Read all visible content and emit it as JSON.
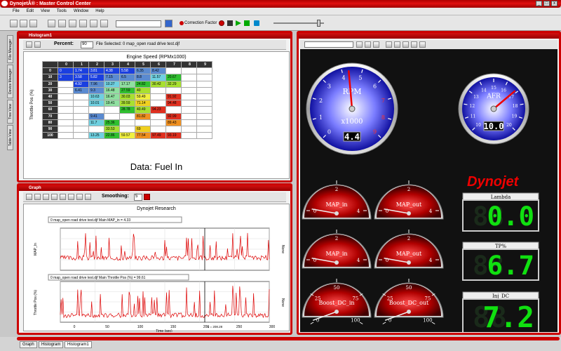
{
  "app": {
    "title": "DynojetÂ® : Master Control Center"
  },
  "menu": [
    "File",
    "Edit",
    "View",
    "Tools",
    "Window",
    "Help"
  ],
  "toolbar": {
    "correction_factor": "Correction Factor"
  },
  "histogram": {
    "window_title": "Histogram1",
    "percent_label": "Percent:",
    "percent_value": "90",
    "file_selected": "File Selected: 0 map_open road drive test.djf",
    "chart_title": "Engine Speed (RPMx1000)",
    "y_label": "Throttle Pos (%)",
    "data_caption": "Data: Fuel In",
    "columns": [
      "0",
      "1",
      "2",
      "3",
      "4",
      "5",
      "6",
      "7",
      "8",
      "9"
    ],
    "rows": [
      {
        "label": "0",
        "cells": [
          "0",
          "1.74",
          "3.81",
          "4.38",
          "5.58",
          "6.35",
          "8.42",
          "",
          "",
          ""
        ]
      },
      {
        "label": "10",
        "cells": [
          "3",
          "3.58",
          "5.82",
          "7.15",
          "6.5",
          "8.8",
          "11.57",
          "20.67",
          "",
          ""
        ]
      },
      {
        "label": "20",
        "cells": [
          "",
          "4.92",
          "7.96",
          "10.27",
          "17.17",
          "24.82",
          "30.42",
          "32.29",
          "",
          ""
        ]
      },
      {
        "label": "30",
        "cells": [
          "",
          "6.41",
          "9.3",
          "16.48",
          "27.59",
          "40",
          "",
          "",
          "",
          ""
        ]
      },
      {
        "label": "40",
        "cells": [
          "",
          "",
          "10.63",
          "16.47",
          "30.03",
          "59.49",
          "",
          "91.92",
          "",
          ""
        ]
      },
      {
        "label": "50",
        "cells": [
          "",
          "",
          "10.01",
          "19.41",
          "39.59",
          "71.14",
          "",
          "94.48",
          "",
          ""
        ]
      },
      {
        "label": "60",
        "cells": [
          "",
          "",
          "",
          "",
          "28.78",
          "40.49",
          "94.23",
          "",
          "",
          ""
        ]
      },
      {
        "label": "70",
        "cells": [
          "",
          "",
          "9.41",
          "",
          "",
          "81.82",
          "",
          "92.99",
          "",
          ""
        ]
      },
      {
        "label": "80",
        "cells": [
          "",
          "",
          "11.7",
          "25.36",
          "",
          "",
          "",
          "89.43",
          "",
          ""
        ]
      },
      {
        "label": "90",
        "cells": [
          "",
          "",
          "",
          "33.53",
          "",
          "69",
          "",
          "",
          "",
          ""
        ]
      },
      {
        "label": "100",
        "cells": [
          "",
          "",
          "13.25",
          "22.86",
          "59.57",
          "77.54",
          "97.49",
          "93.19",
          "",
          ""
        ]
      }
    ]
  },
  "graph": {
    "window_title": "Graph",
    "smoothing_label": "Smoothing:",
    "smoothing_value": "5",
    "title": "Dynojet Research",
    "legend1": "0 map_open road drive test.djf Main MAP_in = 4.33",
    "legend2": "0 map_open road drive test.djf Main Throttle Pos (%) = 99.61",
    "ylabel1": "MAP_In",
    "ylabel2": "Throttle Pos (%)",
    "right_label1": "None",
    "right_label2": "None",
    "xlabel": "Time (sec)",
    "cursor_readout": "x = 208.28",
    "x_ticks": [
      "0",
      "50",
      "100",
      "150",
      "200",
      "250",
      "300"
    ]
  },
  "gauges": {
    "rpm": {
      "label": "RPM",
      "unit": "x1000",
      "digital": "4.4",
      "ticks": [
        "0",
        "1",
        "2",
        "3",
        "4",
        "5",
        "6",
        "7",
        "8",
        "9"
      ]
    },
    "afr": {
      "label": "AFR",
      "digital": "10.0",
      "ticks": [
        "10",
        "11",
        "12",
        "13",
        "14",
        "15",
        "16",
        "17",
        "18",
        "19",
        "20"
      ]
    },
    "brand": "Dynojet",
    "small": [
      {
        "label": "MAP_in",
        "ticks": [
          "0",
          "2",
          "4"
        ]
      },
      {
        "label": "MAP_out",
        "ticks": [
          "0",
          "2",
          "4"
        ]
      },
      {
        "label": "MAP_in",
        "ticks": [
          "0",
          "2",
          "4"
        ]
      },
      {
        "label": "MAP_out",
        "ticks": [
          "0",
          "2",
          "4"
        ]
      },
      {
        "label": "Boost_DC_in",
        "ticks": [
          "0",
          "25",
          "50",
          "75",
          "100"
        ]
      },
      {
        "label": "Boost_DC_out",
        "ticks": [
          "0",
          "25",
          "50",
          "75",
          "100"
        ]
      }
    ],
    "digital": [
      {
        "label": "Lambda",
        "value": "0.0"
      },
      {
        "label": "TP%",
        "value": "6.7"
      },
      {
        "label": "Inj_DC",
        "value": "7.2"
      }
    ]
  },
  "side_tabs": [
    "File Manager",
    "Device Manager",
    "Tree View",
    "Table View"
  ],
  "bottom_tabs": [
    "Graph",
    "Histogram",
    "Histogram1"
  ]
}
